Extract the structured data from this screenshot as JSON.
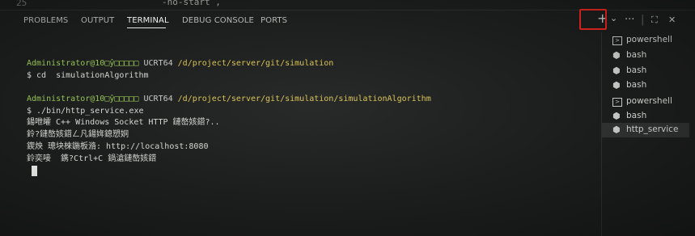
{
  "editor": {
    "line_number": "25",
    "code_fragment": "-no-start ,"
  },
  "tabs": [
    {
      "label": "PROBLEMS"
    },
    {
      "label": "OUTPUT"
    },
    {
      "label": "TERMINAL"
    },
    {
      "label": "DEBUG CONSOLE"
    },
    {
      "label": "PORTS"
    }
  ],
  "actions": {
    "new_terminal": "+",
    "dropdown": "⌄",
    "more": "···",
    "divider": "|",
    "maximize": "⛶",
    "close": "✕"
  },
  "terminal": {
    "prompt1": {
      "user": "Administrator@10□ŷ□□□□□",
      "env": " UCRT64 ",
      "path": "/d/project/server/git/simulation"
    },
    "cmd1": "$ cd  simulationAlgorithm",
    "prompt2": {
      "user": "Administrator@10□ŷ□□□□□",
      "env": " UCRT64 ",
      "path": "/d/project/server/git/simulation/simulationAlgorithm"
    },
    "cmd2": "$ ./bin/http_service.exe",
    "out1": "鍚呭皬 C++ Windows Socket HTTP 鏈嶅姟鍣?..",
    "out2": "鈴?鏈嶅姟鍣ㄥ凡鍚姩鎴愬姛",
    "out3": "鍥炴 璁块棶鍦板潃: http://localhost:8080",
    "out4": "鈴奕唼  鎸?Ctrl+C 鍋滄鏈嶅姟鍣"
  },
  "sidebar": {
    "items": [
      {
        "icon": "powershell-icon",
        "label": "powershell"
      },
      {
        "icon": "bash-icon",
        "label": "bash"
      },
      {
        "icon": "bash-icon",
        "label": "bash"
      },
      {
        "icon": "bash-icon",
        "label": "bash"
      },
      {
        "icon": "powershell-icon",
        "label": "powershell"
      },
      {
        "icon": "bash-icon",
        "label": "bash"
      },
      {
        "icon": "bash-icon",
        "label": "http_service"
      }
    ]
  },
  "colors": {
    "highlight_box": "#e0261f",
    "prompt_user": "#95c155",
    "prompt_path": "#d8c150"
  }
}
